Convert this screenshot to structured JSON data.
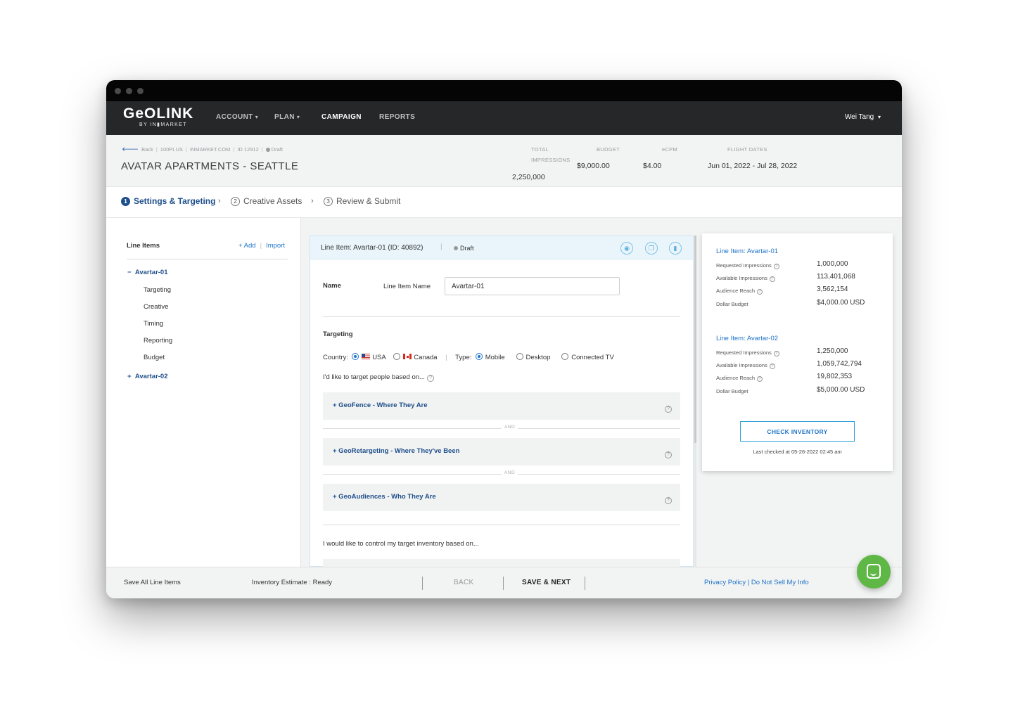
{
  "nav": {
    "logo_main": "GeOLINK",
    "logo_sub": "BY IN▮MARKET",
    "items": [
      {
        "label": "ACCOUNT",
        "caret": "▾"
      },
      {
        "label": "PLAN",
        "caret": "▾"
      },
      {
        "label": "CAMPAIGN"
      },
      {
        "label": "REPORTS"
      }
    ],
    "user": "Wei Tang",
    "user_caret": "▾"
  },
  "breadcrumb": {
    "back": "Back",
    "parts": [
      "100PLUS",
      "INMARKET.COM",
      "ID 12912"
    ],
    "status": "Draft"
  },
  "campaign": {
    "title": "AVATAR APARTMENTS - SEATTLE",
    "stats": {
      "impressions_label": "TOTAL IMPRESSIONS",
      "impressions_value": "2,250,000",
      "budget_label": "BUDGET",
      "budget_value": "$9,000.00",
      "ecpm_label": "eCPM",
      "ecpm_value": "$4.00",
      "flight_label": "FLIGHT DATES",
      "flight_value": "Jun 01, 2022 - Jul 28, 2022"
    }
  },
  "steps": [
    {
      "num": "1",
      "label": "Settings & Targeting"
    },
    {
      "num": "2",
      "label": "Creative Assets"
    },
    {
      "num": "3",
      "label": "Review & Submit"
    }
  ],
  "step_arrow": "›",
  "sidebar": {
    "title": "Line Items",
    "add": "+ Add",
    "import": "Import",
    "items": [
      {
        "label": "Avartar-01",
        "toggle": "−",
        "subs": [
          "Targeting",
          "Creative",
          "Timing",
          "Reporting",
          "Budget"
        ]
      },
      {
        "label": "Avartar-02",
        "toggle": "+"
      }
    ]
  },
  "form": {
    "header_title": "Line Item: Avartar-01 (ID: 40892)",
    "header_status": "Draft",
    "name_section": "Name",
    "name_label": "Line Item Name",
    "name_value": "Avartar-01",
    "targeting_section": "Targeting",
    "country_label": "Country:",
    "country_usa": "USA",
    "country_canada": "Canada",
    "type_label": "Type:",
    "type_mobile": "Mobile",
    "type_desktop": "Desktop",
    "type_ctv": "Connected TV",
    "target_prompt": "I'd like to target people based on...",
    "accordions": [
      "+ GeoFence - Where They Are",
      "+ GeoRetargeting - Where They've Been",
      "+ GeoAudiences - Who They Are"
    ],
    "and_text": "AND",
    "inventory_prompt": "I would like to control my target inventory based on..."
  },
  "inventory": {
    "line_items": [
      {
        "title": "Line Item: Avartar-01",
        "rows": [
          {
            "label": "Requested Impressions",
            "value": "1,000,000",
            "help": true
          },
          {
            "label": "Available Impressions",
            "value": "113,401,068",
            "help": true
          },
          {
            "label": "Audience Reach",
            "value": "3,562,154",
            "help": true
          },
          {
            "label": "Dollar Budget",
            "value": "$4,000.00 USD"
          }
        ]
      },
      {
        "title": "Line Item: Avartar-02",
        "rows": [
          {
            "label": "Requested Impressions",
            "value": "1,250,000",
            "help": true
          },
          {
            "label": "Available Impressions",
            "value": "1,059,742,794",
            "help": true
          },
          {
            "label": "Audience Reach",
            "value": "19,802,353",
            "help": true
          },
          {
            "label": "Dollar Budget",
            "value": "$5,000.00 USD"
          }
        ]
      }
    ],
    "check_button": "CHECK INVENTORY",
    "last_checked": "Last checked at 05-26-2022 02:45 am"
  },
  "footer": {
    "save_all": "Save All Line Items",
    "estimate": "Inventory Estimate : Ready",
    "back": "BACK",
    "save_next": "SAVE & NEXT",
    "privacy": "Privacy Policy",
    "link_sep": "|",
    "do_not_sell": "Do Not Sell My Info"
  },
  "icons": {
    "back": "arrow-left-icon",
    "help": "question-circle-icon",
    "chat": "chat-icon"
  },
  "colors": {
    "brand_blue": "#1e4f8b",
    "link_blue": "#1e73c8",
    "nav_dark": "#262728",
    "chat_green": "#5fb846"
  }
}
